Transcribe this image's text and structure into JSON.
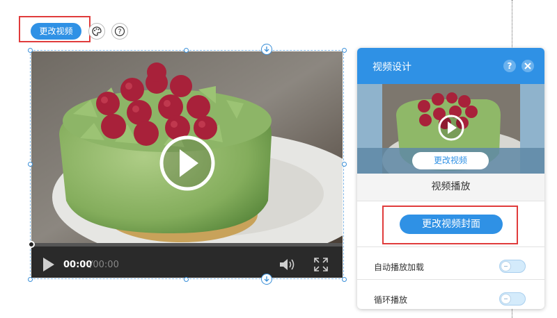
{
  "toolbar": {
    "change_video_label": "更改视频",
    "palette_icon": "palette-icon",
    "help_icon": "help-icon"
  },
  "player": {
    "current_time": "00:00",
    "total_time": "/00:00",
    "play_icon": "play-icon",
    "volume_icon": "volume-icon",
    "fullscreen_icon": "fullscreen-icon",
    "progress": 0
  },
  "panel": {
    "title": "视频设计",
    "help_icon": "help-icon",
    "close_icon": "close-icon",
    "preview_button_label": "更改视频",
    "section_label": "视频播放",
    "cover_button_label": "更改视频封面",
    "settings": [
      {
        "label": "自动播放加载",
        "enabled": false
      },
      {
        "label": "循环播放",
        "enabled": false
      }
    ]
  },
  "colors": {
    "accent": "#2f91e5",
    "highlight": "#e03b3b"
  }
}
